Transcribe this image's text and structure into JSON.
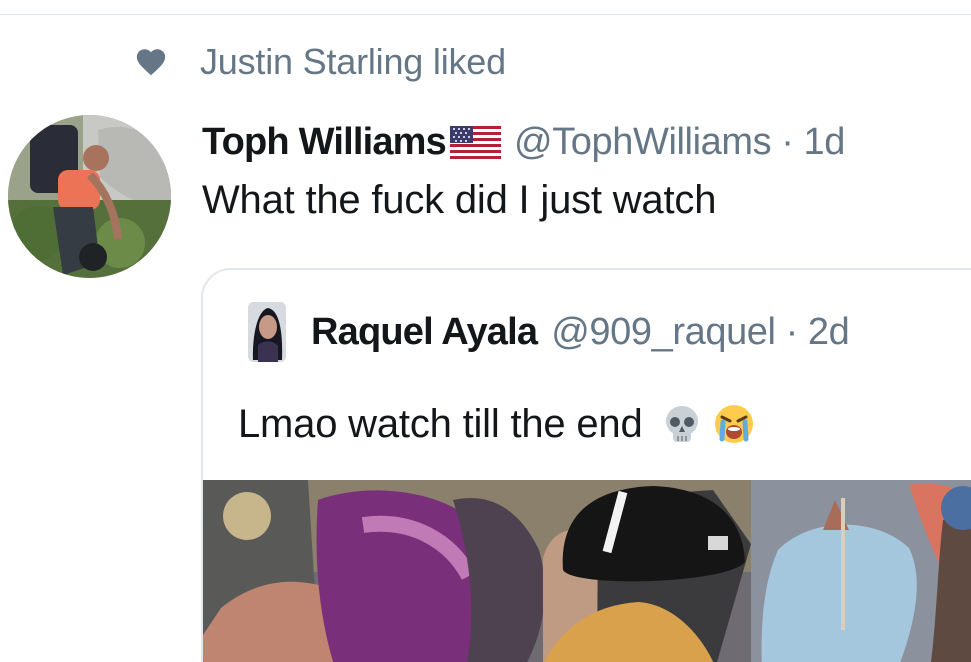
{
  "social_context": {
    "text": "Justin Starling liked",
    "icon": "heart-icon"
  },
  "tweet": {
    "author_name": "Toph Williams",
    "author_flag_icon": "us-flag-icon",
    "author_handle": "@TophWilliams",
    "separator": "·",
    "timestamp": "1d",
    "text": "What the fuck did I just watch"
  },
  "quoted_tweet": {
    "author_name": "Raquel Ayala",
    "author_handle": "@909_raquel",
    "separator": "·",
    "timestamp": "2d",
    "text": "Lmao watch till the end",
    "emoji_icons": [
      "skull-icon",
      "loudly-crying-face-icon"
    ]
  },
  "colors": {
    "primary_text": "#14171a",
    "secondary_text": "#657786",
    "border": "#e1e8ed",
    "background": "#ffffff"
  }
}
